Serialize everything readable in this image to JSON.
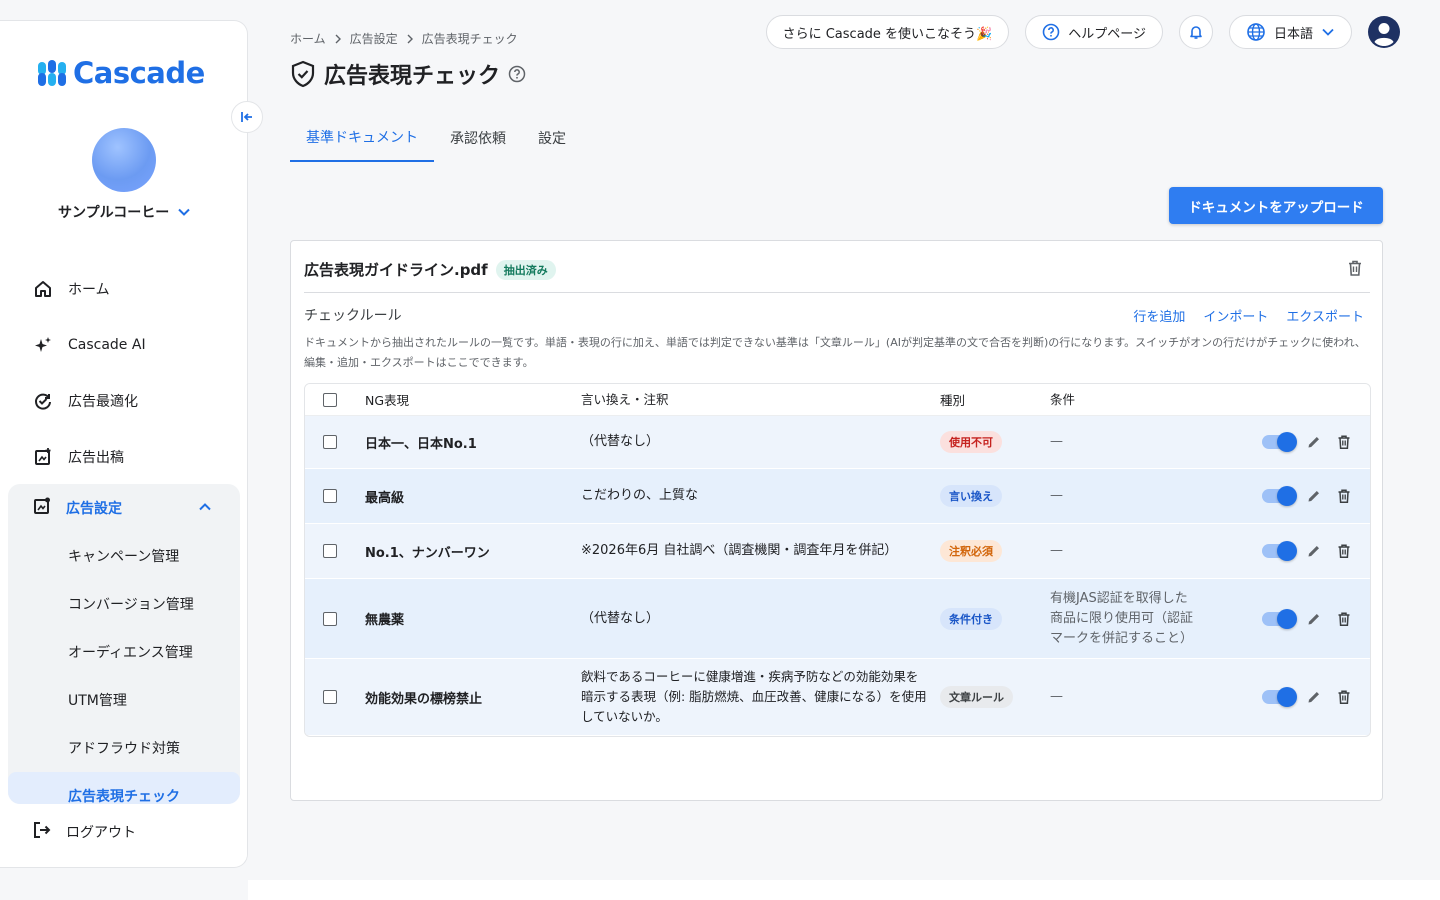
{
  "app": {
    "logo_text": "Cascade"
  },
  "sidebar": {
    "account_name": "サンプルコーヒー",
    "items": [
      {
        "label": "ホーム",
        "icon": "home-icon"
      },
      {
        "label": "Cascade AI",
        "icon": "sparkle-icon"
      },
      {
        "label": "広告最適化",
        "icon": "optimize-icon"
      },
      {
        "label": "広告出稿",
        "icon": "publish-icon"
      }
    ],
    "group": {
      "label": "広告設定",
      "icon": "ad-settings-icon",
      "sub_items": [
        "キャンペーン管理",
        "コンバージョン管理",
        "オーディエンス管理",
        "UTM管理",
        "アドフラウド対策",
        "広告表現チェック"
      ]
    },
    "logout_label": "ログアウト"
  },
  "header": {
    "breadcrumb": [
      "ホーム",
      "広告設定",
      "広告表現チェック"
    ],
    "title": "広告表現チェック",
    "promo_label": "さらに Cascade を使いこなそう🎉",
    "help_label": "ヘルプページ",
    "language_label": "日本語"
  },
  "tabs": [
    {
      "label": "基準ドキュメント",
      "active": true
    },
    {
      "label": "承認依頼",
      "active": false
    },
    {
      "label": "設定",
      "active": false
    }
  ],
  "upload_button_label": "ドキュメントをアップロード",
  "document": {
    "file_name": "広告表現ガイドライン.pdf",
    "status_badge": "抽出済み",
    "rules_label": "チェックルール",
    "actions": {
      "add_row": "行を追加",
      "import": "インポート",
      "export": "エクスポート"
    },
    "description": "ドキュメントから抽出されたルールの一覧です。単語・表現の行に加え、単語では判定できない基準は「文章ルール」(AIが判定基準の文で合否を判断)の行になります。スイッチがオンの行だけがチェックに使われ、編集・追加・エクスポートはここでできます。",
    "columns": {
      "ng": "NG表現",
      "alt": "言い換え・注釈",
      "type": "種別",
      "cond": "条件"
    },
    "rows": [
      {
        "ng": "日本一、日本No.1",
        "alt": "（代替なし）",
        "type": "使用不可",
        "type_color": "red",
        "cond": "—",
        "enabled": true
      },
      {
        "ng": "最高級",
        "alt": "こだわりの、上質な",
        "type": "言い換え",
        "type_color": "blue",
        "cond": "—",
        "enabled": true
      },
      {
        "ng": "No.1、ナンバーワン",
        "alt": "※2026年6月 自社調べ（調査機関・調査年月を併記）",
        "type": "注釈必須",
        "type_color": "orange",
        "cond": "—",
        "enabled": true
      },
      {
        "ng": "無農薬",
        "alt": "（代替なし）",
        "type": "条件付き",
        "type_color": "blue",
        "cond": "有機JAS認証を取得した商品に限り使用可（認証マークを併記すること）",
        "enabled": true
      },
      {
        "ng": "効能効果の標榜禁止",
        "alt": "飲料であるコーヒーに健康増進・疾病予防などの効能効果を暗示する表現（例: 脂肪燃焼、血圧改善、健康になる）を使用していないか。",
        "type": "文章ルール",
        "type_color": "gray",
        "cond": "—",
        "enabled": true
      }
    ]
  },
  "colors": {
    "accent": "#1f6fe5",
    "button": "#2f7df1"
  }
}
